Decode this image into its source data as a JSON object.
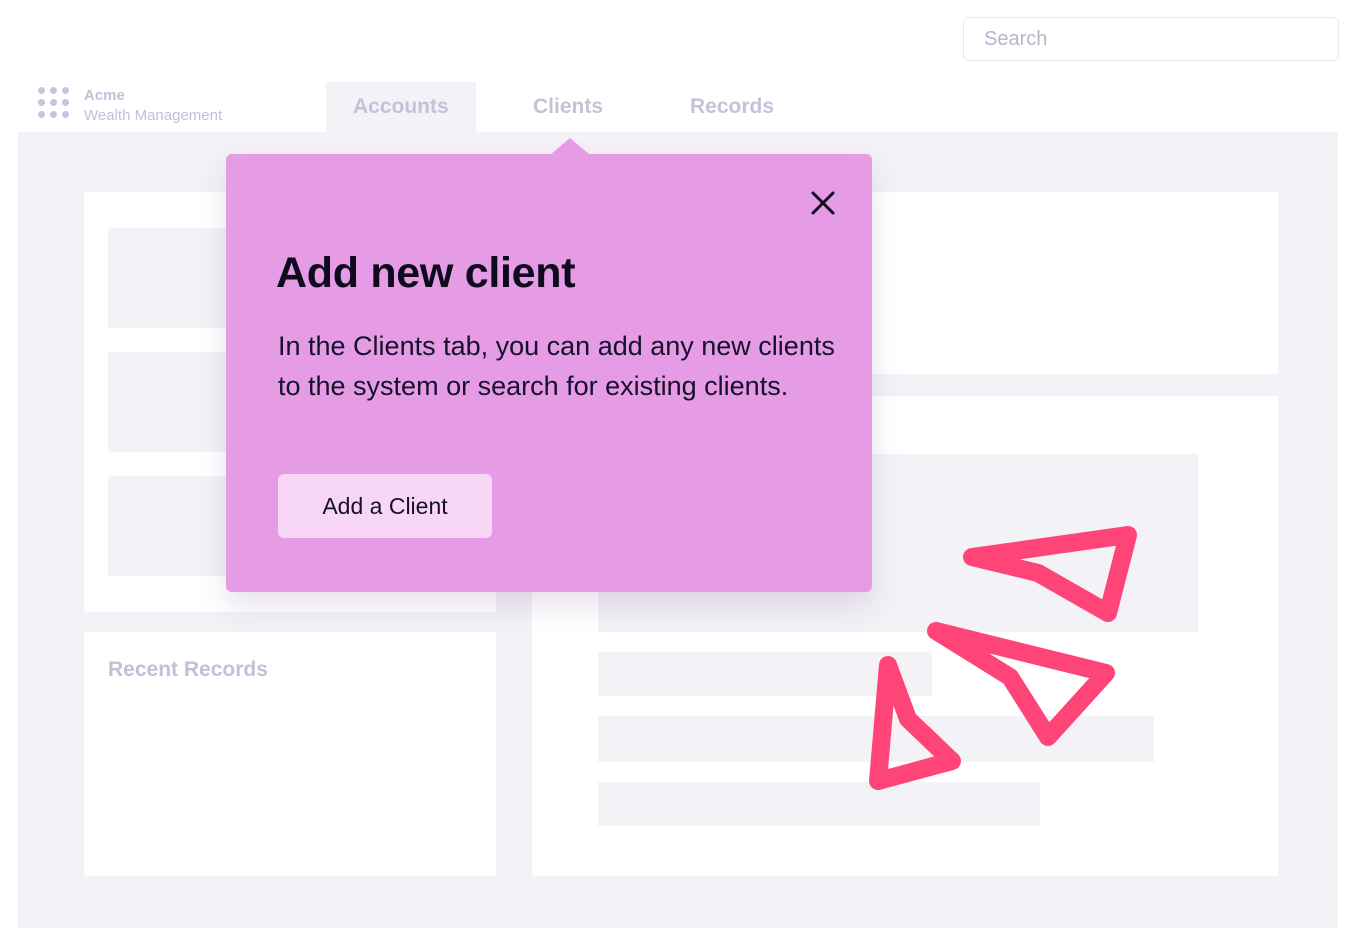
{
  "search": {
    "placeholder": "Search"
  },
  "brand": {
    "name": "Acme",
    "subtitle": "Wealth Management"
  },
  "tabs": [
    {
      "label": "Accounts",
      "active": true
    },
    {
      "label": "Clients",
      "active": false
    },
    {
      "label": "Records",
      "active": false
    }
  ],
  "recent_records": {
    "title": "Recent Records"
  },
  "popover": {
    "title": "Add new client",
    "body": "In the Clients tab, you can add any new clients to the system or search for existing clients.",
    "button_label": "Add a Client",
    "close_icon": "close-icon",
    "background": "#e69be5",
    "button_background": "#f7d6f6"
  },
  "colors": {
    "accent_doodle": "#ff4477",
    "panel_bg": "#f3f2f7",
    "muted_text": "#c2bfd6"
  }
}
